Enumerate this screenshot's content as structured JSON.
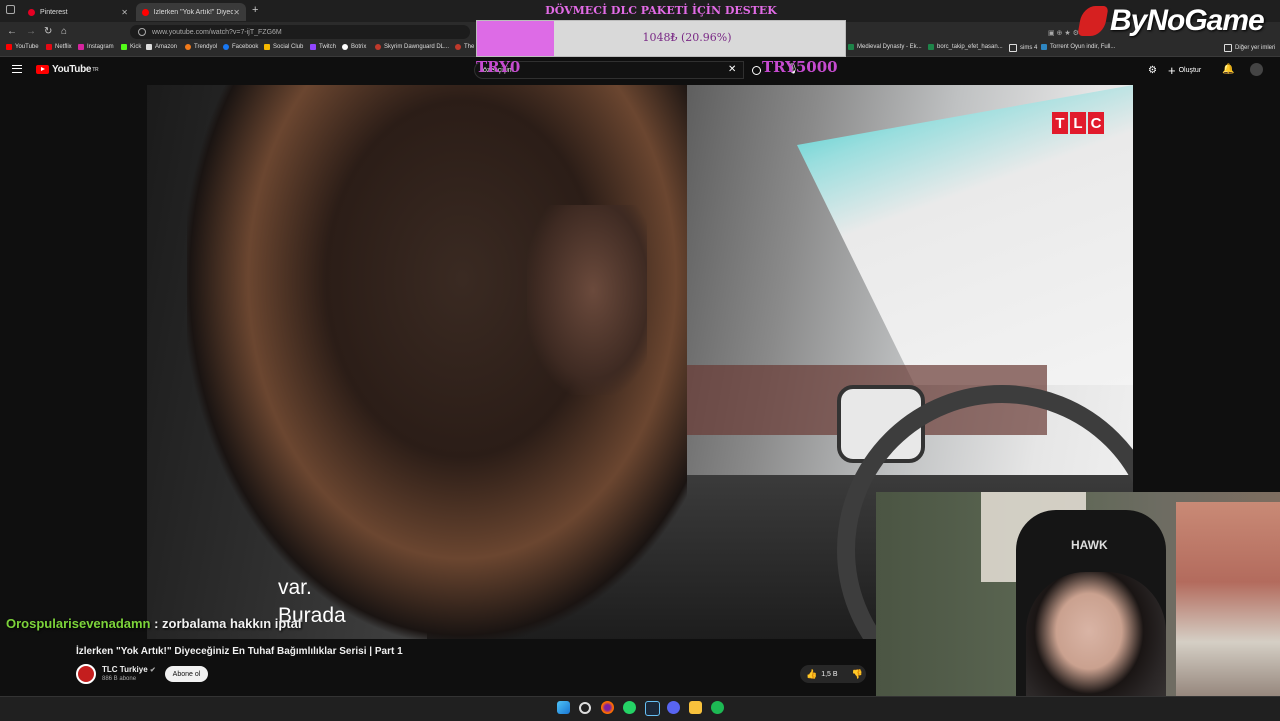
{
  "browser": {
    "tabs": [
      {
        "label": "Pinterest",
        "active": false
      },
      {
        "label": "İzlerken \"Yok Artık!\" Diyeceğini",
        "active": true
      }
    ],
    "new_tab_symbol": "+",
    "url": "www.youtube.com/watch?v=7-ijT_FZG6M",
    "bookmarks_left": [
      "YouTube",
      "Netflix",
      "Instagram",
      "Kick",
      "Amazon",
      "Trendyol",
      "Facebook",
      "Social Club",
      "Twitch",
      "Botrix",
      "Skyrim Dawnguard DL...",
      "The E"
    ],
    "bookmarks_right": [
      "Medieval Dynasty - Ek...",
      "borc_takip_efet_hasan...",
      "sims 4",
      "Torrent Oyun indir, Full..."
    ],
    "other_bookmarks": "Diğer yer imleri"
  },
  "youtube": {
    "logo_text": "YouTube",
    "logo_country": "TR",
    "search_value": "özel çiçim",
    "create_label": "Oluştur"
  },
  "donation": {
    "title": "DÖVMECİ DLC PAKETİ İÇİN DESTEK",
    "progress_text": "1048₺ (20.96%)",
    "progress_fraction": 0.2096,
    "start_label": "TRY0",
    "goal_label": "TRY5000",
    "fill_color": "#dd6be6"
  },
  "brand": {
    "text": "ByNoGame"
  },
  "video": {
    "channel_logo": [
      "T",
      "L",
      "C"
    ],
    "subtitle_lines": [
      "var.",
      "Burada"
    ],
    "title": "İzlerken \"Yok Artık!\" Diyeceğiniz En Tuhaf Bağımlılıklar Serisi | Part 1",
    "channel_name": "TLC Turkiye",
    "channel_subs": "886 B abone",
    "subscribe_label": "Abone ol",
    "likes": "1,5 B"
  },
  "chat": {
    "user": "Orospularisevenadamn",
    "message": " : zorbalama hakkın iptal"
  },
  "webcam": {
    "chair_text": "HAWK"
  },
  "taskbar_icons": [
    "windows-icon",
    "search-icon",
    "firefox-icon",
    "whatsapp-icon",
    "steam-icon",
    "discord-icon",
    "folder-icon",
    "spotify-icon"
  ]
}
